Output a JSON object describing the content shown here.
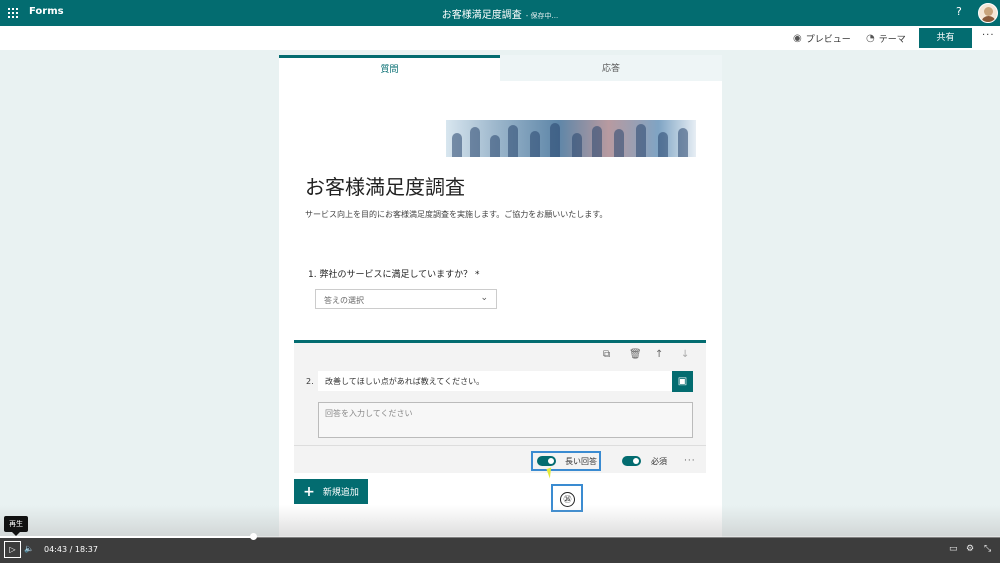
{
  "colors": {
    "brand": "#036c70",
    "highlight": "#3a8bd1"
  },
  "topbar": {
    "app_name": "Forms",
    "doc_title": "お客様満足度調査",
    "status": "- 保存中...",
    "help": "?"
  },
  "command_bar": {
    "preview_label": "プレビュー",
    "preview_icon": "eye-icon",
    "theme_label": "テーマ",
    "theme_icon": "palette-icon",
    "share_label": "共有",
    "more": "···"
  },
  "tabs": [
    {
      "label": "質問",
      "active": true
    },
    {
      "label": "応答",
      "active": false
    }
  ],
  "form": {
    "title": "お客様満足度調査",
    "description": "サービス向上を目的にお客様満足度調査を実施します。ご協力をお願いいたします。"
  },
  "question1": {
    "text": "1. 弊社のサービスに満足していますか？ *",
    "placeholder": "答えの選択"
  },
  "question2": {
    "number": "2.",
    "text": "改善してほしい点があれば教えてください。",
    "answer_placeholder": "回答を入力してください",
    "long_answer_label": "長い回答",
    "long_answer_on": true,
    "required_label": "必須",
    "required_on": true,
    "more": "···"
  },
  "callout": {
    "number": "㉖"
  },
  "add_button": {
    "label": "新規追加"
  },
  "player": {
    "tooltip": "再生",
    "current_time": "04:43",
    "separator": "/",
    "total_time": "18:37",
    "progress": 0.2533
  }
}
